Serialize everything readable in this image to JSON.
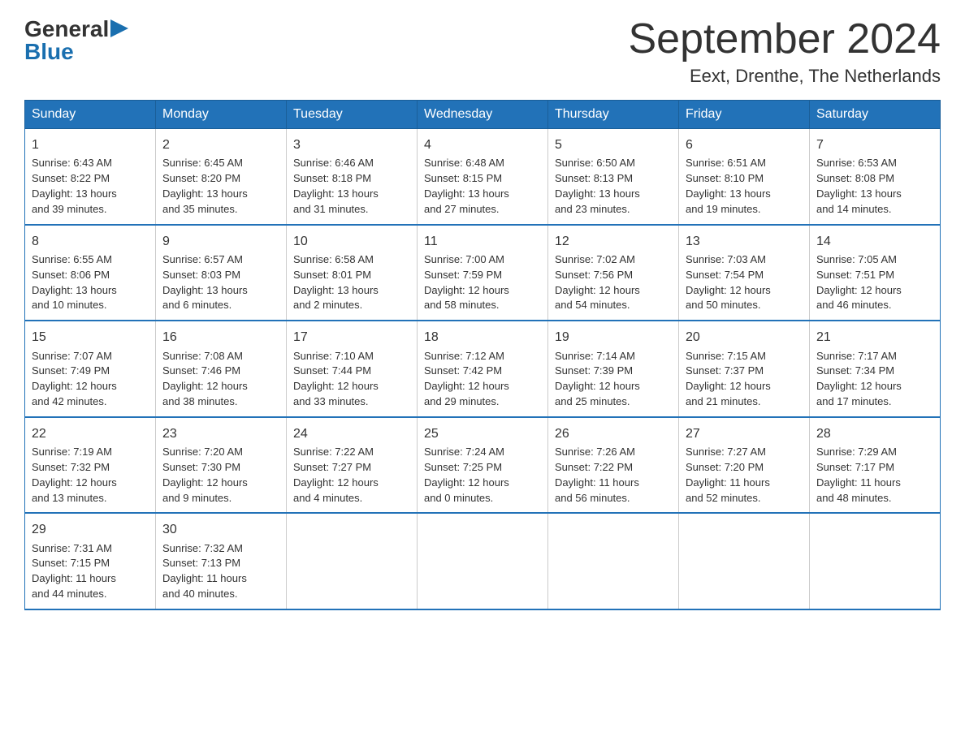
{
  "header": {
    "logo_general": "General",
    "logo_blue": "Blue",
    "month_title": "September 2024",
    "location": "Eext, Drenthe, The Netherlands"
  },
  "days_of_week": [
    "Sunday",
    "Monday",
    "Tuesday",
    "Wednesday",
    "Thursday",
    "Friday",
    "Saturday"
  ],
  "weeks": [
    [
      {
        "day": "1",
        "sunrise": "6:43 AM",
        "sunset": "8:22 PM",
        "daylight": "13 hours and 39 minutes."
      },
      {
        "day": "2",
        "sunrise": "6:45 AM",
        "sunset": "8:20 PM",
        "daylight": "13 hours and 35 minutes."
      },
      {
        "day": "3",
        "sunrise": "6:46 AM",
        "sunset": "8:18 PM",
        "daylight": "13 hours and 31 minutes."
      },
      {
        "day": "4",
        "sunrise": "6:48 AM",
        "sunset": "8:15 PM",
        "daylight": "13 hours and 27 minutes."
      },
      {
        "day": "5",
        "sunrise": "6:50 AM",
        "sunset": "8:13 PM",
        "daylight": "13 hours and 23 minutes."
      },
      {
        "day": "6",
        "sunrise": "6:51 AM",
        "sunset": "8:10 PM",
        "daylight": "13 hours and 19 minutes."
      },
      {
        "day": "7",
        "sunrise": "6:53 AM",
        "sunset": "8:08 PM",
        "daylight": "13 hours and 14 minutes."
      }
    ],
    [
      {
        "day": "8",
        "sunrise": "6:55 AM",
        "sunset": "8:06 PM",
        "daylight": "13 hours and 10 minutes."
      },
      {
        "day": "9",
        "sunrise": "6:57 AM",
        "sunset": "8:03 PM",
        "daylight": "13 hours and 6 minutes."
      },
      {
        "day": "10",
        "sunrise": "6:58 AM",
        "sunset": "8:01 PM",
        "daylight": "13 hours and 2 minutes."
      },
      {
        "day": "11",
        "sunrise": "7:00 AM",
        "sunset": "7:59 PM",
        "daylight": "12 hours and 58 minutes."
      },
      {
        "day": "12",
        "sunrise": "7:02 AM",
        "sunset": "7:56 PM",
        "daylight": "12 hours and 54 minutes."
      },
      {
        "day": "13",
        "sunrise": "7:03 AM",
        "sunset": "7:54 PM",
        "daylight": "12 hours and 50 minutes."
      },
      {
        "day": "14",
        "sunrise": "7:05 AM",
        "sunset": "7:51 PM",
        "daylight": "12 hours and 46 minutes."
      }
    ],
    [
      {
        "day": "15",
        "sunrise": "7:07 AM",
        "sunset": "7:49 PM",
        "daylight": "12 hours and 42 minutes."
      },
      {
        "day": "16",
        "sunrise": "7:08 AM",
        "sunset": "7:46 PM",
        "daylight": "12 hours and 38 minutes."
      },
      {
        "day": "17",
        "sunrise": "7:10 AM",
        "sunset": "7:44 PM",
        "daylight": "12 hours and 33 minutes."
      },
      {
        "day": "18",
        "sunrise": "7:12 AM",
        "sunset": "7:42 PM",
        "daylight": "12 hours and 29 minutes."
      },
      {
        "day": "19",
        "sunrise": "7:14 AM",
        "sunset": "7:39 PM",
        "daylight": "12 hours and 25 minutes."
      },
      {
        "day": "20",
        "sunrise": "7:15 AM",
        "sunset": "7:37 PM",
        "daylight": "12 hours and 21 minutes."
      },
      {
        "day": "21",
        "sunrise": "7:17 AM",
        "sunset": "7:34 PM",
        "daylight": "12 hours and 17 minutes."
      }
    ],
    [
      {
        "day": "22",
        "sunrise": "7:19 AM",
        "sunset": "7:32 PM",
        "daylight": "12 hours and 13 minutes."
      },
      {
        "day": "23",
        "sunrise": "7:20 AM",
        "sunset": "7:30 PM",
        "daylight": "12 hours and 9 minutes."
      },
      {
        "day": "24",
        "sunrise": "7:22 AM",
        "sunset": "7:27 PM",
        "daylight": "12 hours and 4 minutes."
      },
      {
        "day": "25",
        "sunrise": "7:24 AM",
        "sunset": "7:25 PM",
        "daylight": "12 hours and 0 minutes."
      },
      {
        "day": "26",
        "sunrise": "7:26 AM",
        "sunset": "7:22 PM",
        "daylight": "11 hours and 56 minutes."
      },
      {
        "day": "27",
        "sunrise": "7:27 AM",
        "sunset": "7:20 PM",
        "daylight": "11 hours and 52 minutes."
      },
      {
        "day": "28",
        "sunrise": "7:29 AM",
        "sunset": "7:17 PM",
        "daylight": "11 hours and 48 minutes."
      }
    ],
    [
      {
        "day": "29",
        "sunrise": "7:31 AM",
        "sunset": "7:15 PM",
        "daylight": "11 hours and 44 minutes."
      },
      {
        "day": "30",
        "sunrise": "7:32 AM",
        "sunset": "7:13 PM",
        "daylight": "11 hours and 40 minutes."
      },
      null,
      null,
      null,
      null,
      null
    ]
  ],
  "labels": {
    "sunrise": "Sunrise:",
    "sunset": "Sunset:",
    "daylight": "Daylight:"
  }
}
